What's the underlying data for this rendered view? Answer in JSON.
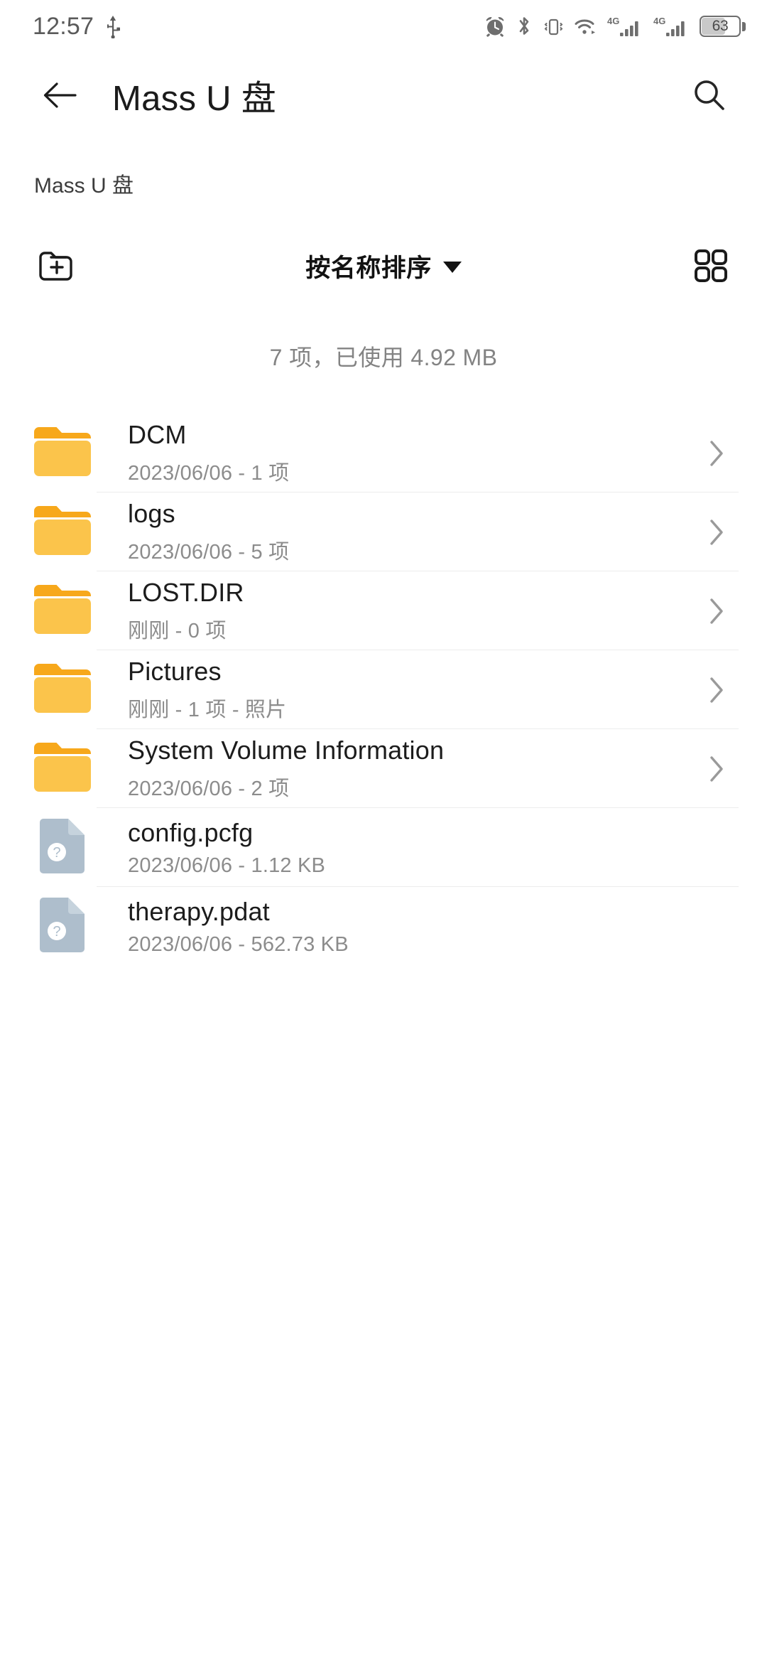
{
  "statusbar": {
    "clock": "12:57",
    "usb_icon": "usb-icon",
    "icons": [
      "alarm-icon",
      "bluetooth-icon",
      "vibrate-icon",
      "wifi-icon",
      "signal-4g-sim1-icon",
      "signal-4g-sim2-icon"
    ],
    "network_label": "4G",
    "battery_percent": "63",
    "battery_level": 63
  },
  "appbar": {
    "back_icon": "arrow-left-icon",
    "title": "Mass U 盘",
    "search_icon": "search-icon"
  },
  "breadcrumb": {
    "path": "Mass U 盘"
  },
  "toolbar": {
    "new_folder_icon": "new-folder-icon",
    "sort_label": "按名称排序",
    "sort_caret": "chevron-down-icon",
    "view_grid_icon": "grid-view-icon"
  },
  "summary": {
    "text": "7 项，已使用 4.92 MB",
    "item_count": 7,
    "used": "4.92 MB"
  },
  "colors": {
    "folder_body": "#F9C council",
    "folder_main": "#FBC košt",
    "accent_folder": "#F8C killed"
  },
  "files": [
    {
      "name": "DCM",
      "meta": "2023/06/06 - 1 项",
      "type": "folder",
      "icon": "folder-icon",
      "chevron": true
    },
    {
      "name": "logs",
      "meta": "2023/06/06 - 5 项",
      "type": "folder",
      "icon": "folder-icon",
      "chevron": true
    },
    {
      "name": "LOST.DIR",
      "meta": "刚刚 - 0 项",
      "type": "folder",
      "icon": "folder-icon",
      "chevron": true
    },
    {
      "name": "Pictures",
      "meta": "刚刚 - 1 项 - 照片",
      "type": "folder",
      "icon": "folder-icon",
      "chevron": true
    },
    {
      "name": "System Volume Information",
      "meta": "2023/06/06 - 2 项",
      "type": "folder",
      "icon": "folder-icon",
      "chevron": true
    },
    {
      "name": "config.pcfg",
      "meta": "2023/06/06 - 1.12 KB",
      "type": "file",
      "icon": "unknown-file-icon",
      "chevron": false
    },
    {
      "name": "therapy.pdat",
      "meta": "2023/06/06 - 562.73 KB",
      "type": "file",
      "icon": "unknown-file-icon",
      "chevron": false
    }
  ]
}
